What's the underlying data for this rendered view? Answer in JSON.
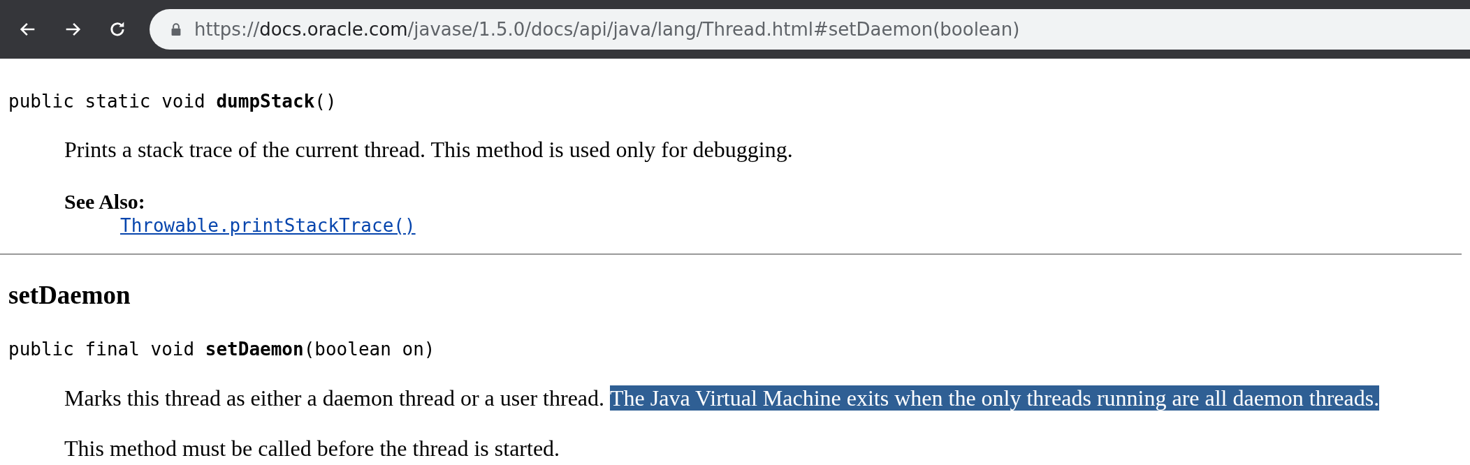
{
  "toolbar": {
    "url_parts": [
      {
        "text": "https://",
        "emphasized": false
      },
      {
        "text": "docs.oracle.com",
        "emphasized": true
      },
      {
        "text": "/javase/1.5.0/docs/api/java/lang/Thread.html#setDaemon(boolean)",
        "emphasized": false
      }
    ]
  },
  "methods": [
    {
      "signature": "public static void **dumpStack**()",
      "paragraphs": [
        [
          {
            "text": "Prints a stack trace of the current thread. This method is used only for debugging.",
            "selected": false
          }
        ]
      ],
      "see_also": {
        "label": "See Also:",
        "link": "Throwable.printStackTrace()"
      }
    },
    {
      "heading": "setDaemon",
      "signature": "public final void **setDaemon**(boolean on)",
      "paragraphs": [
        [
          {
            "text": "Marks this thread as either a daemon thread or a user thread.",
            "selected": false
          },
          {
            "text": "The Java Virtual Machine exits when the only threads running are all daemon threads.",
            "selected": true
          }
        ],
        [
          {
            "text": "This method must be called before the thread is started.",
            "selected": false
          }
        ]
      ]
    }
  ]
}
